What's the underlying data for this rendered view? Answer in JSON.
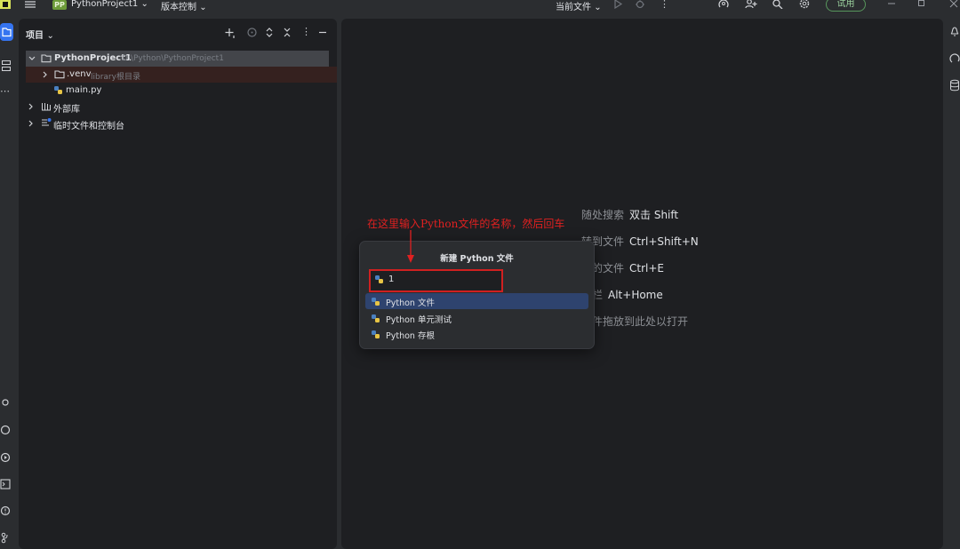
{
  "titlebar": {
    "project_badge": "PP",
    "project_name": "PythonProject1",
    "vcs_menu": "版本控制",
    "run_config": "当前文件",
    "trial_button": "试用"
  },
  "project_panel": {
    "title": "项目",
    "tree": [
      {
        "label": "PythonProject1",
        "secondary": "D:\\Python\\PythonProject1"
      },
      {
        "label": ".venv",
        "secondary": "library根目录"
      },
      {
        "label": "main.py",
        "secondary": ""
      },
      {
        "label": "外部库",
        "secondary": ""
      },
      {
        "label": "临时文件和控制台",
        "secondary": ""
      }
    ]
  },
  "editor_hints": [
    {
      "text": "随处搜索",
      "shortcut": "双击 Shift"
    },
    {
      "text": "转到文件",
      "shortcut": "Ctrl+Shift+N"
    },
    {
      "text": "最近的文件",
      "shortcut": "Ctrl+E"
    },
    {
      "text": "导航栏",
      "shortcut": "Alt+Home"
    },
    {
      "text": "将文件拖放到此处以打开",
      "shortcut": ""
    }
  ],
  "popup": {
    "title": "新建 Python 文件",
    "input_value": "1",
    "items": [
      "Python 文件",
      "Python 单元测试",
      "Python 存根"
    ],
    "selected_index": 0
  },
  "annotation": {
    "text": "在这里输入Python文件的名称，然后回车",
    "color": "#e02020"
  },
  "colors": {
    "accent": "#3574f0",
    "selection": "#2e436e",
    "highlight_border": "#d02020"
  }
}
